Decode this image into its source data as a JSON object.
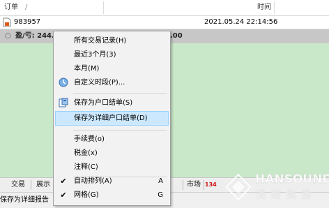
{
  "header": {
    "col_order": "订单",
    "sort_indicator": "/",
    "col_time": "时间"
  },
  "order_row": {
    "order_id": "983957",
    "time": "2021.05.24 22:14:56"
  },
  "summary_row": {
    "label": "盈/亏: 244.",
    "tail": ".00"
  },
  "context_menu": {
    "items": [
      {
        "label": "所有交易记录(H)"
      },
      {
        "label": "最近3个月(3)"
      },
      {
        "label": "本月(M)"
      },
      {
        "label": "自定义时段(P)...",
        "icon": "clock-icon"
      },
      {
        "label": "保存为户口结单(S)",
        "icon": "save-report-icon"
      },
      {
        "label": "保存为详细户口结单(D)",
        "highlighted": true
      },
      {
        "label": "手续费(o)"
      },
      {
        "label": "税金(x)"
      },
      {
        "label": "注释(C)"
      },
      {
        "label": "自动排列(A)",
        "checked": true,
        "accelerator": "A"
      },
      {
        "label": "网格(G)",
        "checked": true,
        "accelerator": "G"
      }
    ]
  },
  "tabs": {
    "trade": "交易",
    "exposure": "展示",
    "market": "市场",
    "badge_count": "134"
  },
  "status": {
    "text": "保存为详细报告"
  },
  "watermark": {
    "latin": "HANSOUND",
    "chinese": "漢聲集團"
  },
  "colors": {
    "list_background": "#c9e8c9",
    "menu_highlight": "#cce8ff",
    "badge_red": "#d01010"
  }
}
